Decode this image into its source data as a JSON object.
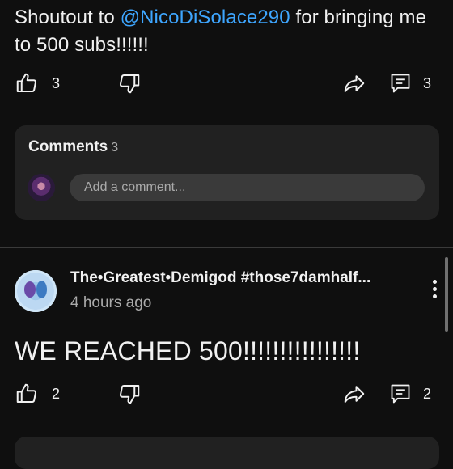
{
  "post1": {
    "text_before": "Shoutout to ",
    "mention": "@NicoDiSolace290",
    "text_after": " for bringing me to 500 subs!!!!!!",
    "like_count": "3",
    "comment_count": "3"
  },
  "comments_panel": {
    "title": "Comments",
    "count": "3",
    "input_placeholder": "Add a comment..."
  },
  "post2": {
    "channel_name": "The•Greatest•Demigod #those7damhalf...",
    "time_ago": "4 hours ago",
    "text": "WE REACHED 500!!!!!!!!!!!!!!!!",
    "like_count": "2",
    "comment_count": "2"
  },
  "icons": {
    "like": "thumbs-up-icon",
    "dislike": "thumbs-down-icon",
    "share": "share-arrow-icon",
    "comment": "comment-icon",
    "more": "more-vertical-icon"
  },
  "colors": {
    "background": "#0f0f0f",
    "mention": "#3ea6ff",
    "panel": "#212121",
    "secondary_text": "#aaaaaa"
  }
}
